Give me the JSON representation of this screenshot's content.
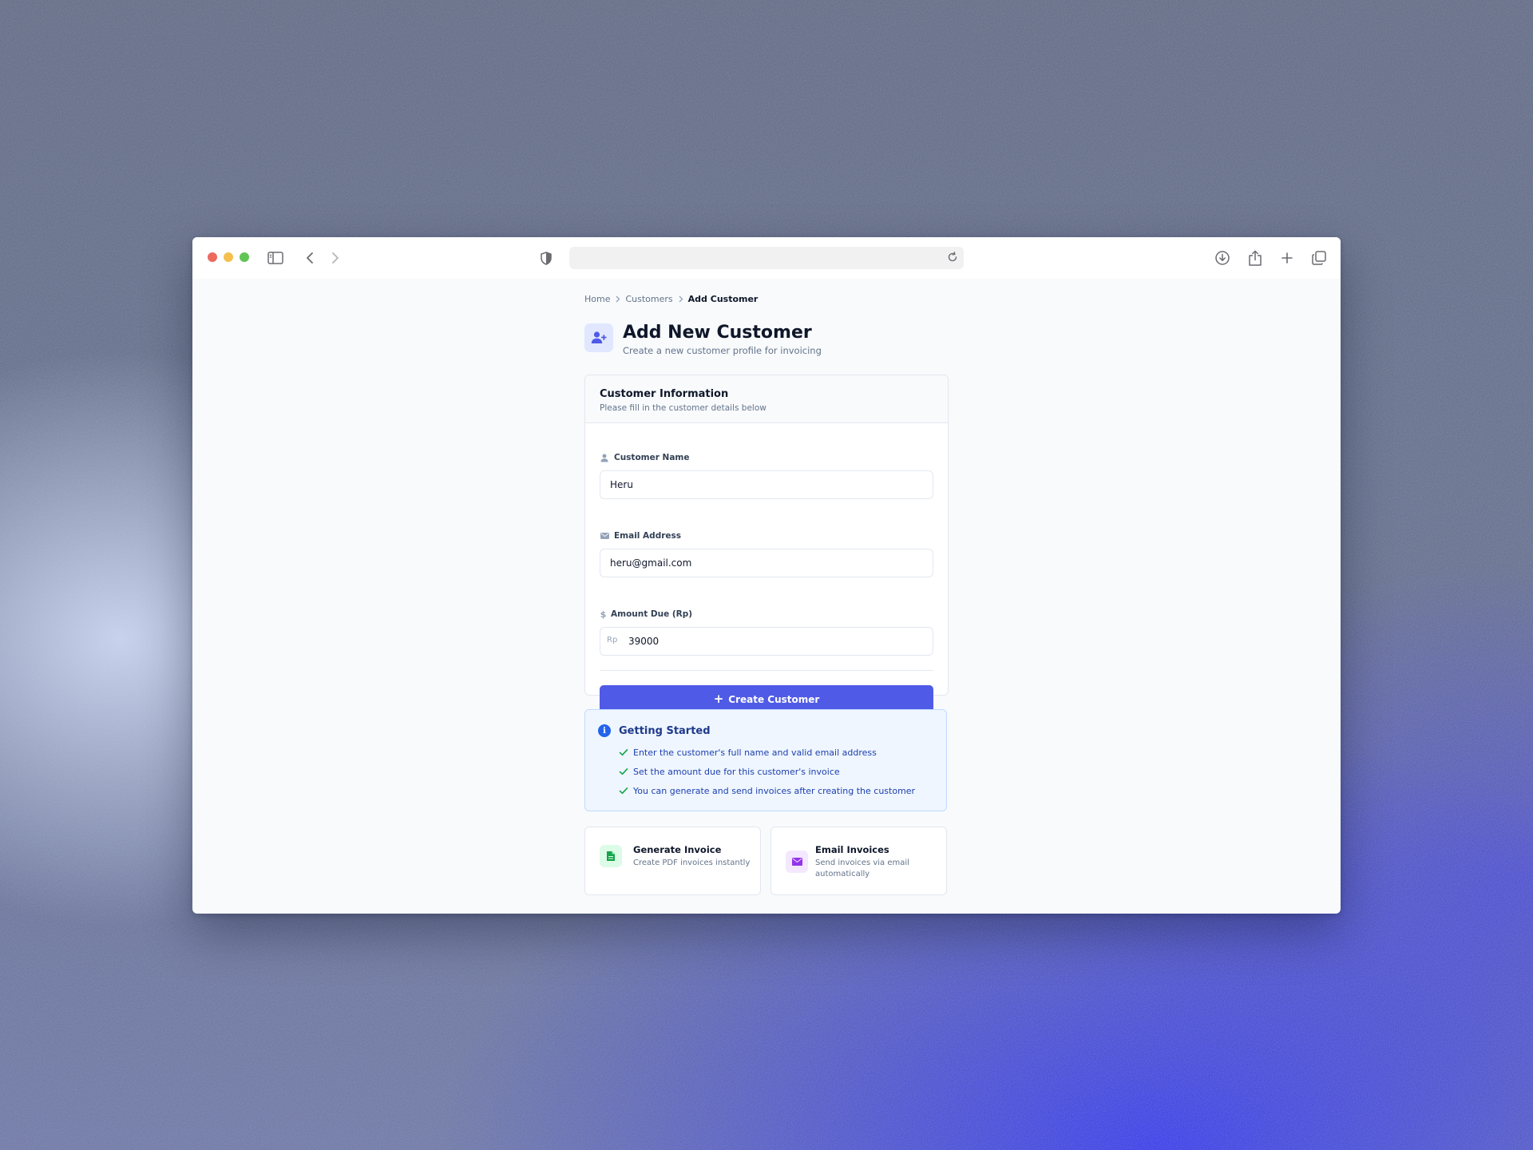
{
  "colors": {
    "primary": "#4f5ae6",
    "info_bg": "#eff6ff",
    "info_text": "#1e40af",
    "check": "#16a34a",
    "feature_green": "#16a34a",
    "feature_purple": "#9333ea"
  },
  "browser": {
    "url": "",
    "icons": [
      "sidebar-toggle-icon",
      "back-icon",
      "forward-icon",
      "shield-icon",
      "reload-icon",
      "download-icon",
      "share-icon",
      "new-tab-icon",
      "tabs-overview-icon"
    ]
  },
  "breadcrumb": {
    "home": "Home",
    "customers": "Customers",
    "current": "Add Customer"
  },
  "header": {
    "title": "Add New Customer",
    "subtitle": "Create a new customer profile for invoicing",
    "icon": "user-plus-icon"
  },
  "form_card": {
    "title": "Customer Information",
    "description": "Please fill in the customer details below",
    "fields": {
      "name": {
        "label": "Customer Name",
        "value": "Heru",
        "icon": "user-icon"
      },
      "email": {
        "label": "Email Address",
        "value": "heru@gmail.com",
        "icon": "mail-icon"
      },
      "amount": {
        "label": "Amount Due (Rp)",
        "prefix": "Rp",
        "value": "39000",
        "icon": "dollar-icon"
      }
    },
    "submit_label": "Create Customer"
  },
  "getting_started": {
    "title": "Getting Started",
    "items": [
      "Enter the customer's full name and valid email address",
      "Set the amount due for this customer's invoice",
      "You can generate and send invoices after creating the customer"
    ]
  },
  "features": [
    {
      "title": "Generate Invoice",
      "description": "Create PDF invoices instantly",
      "icon": "document-icon"
    },
    {
      "title": "Email Invoices",
      "description": "Send invoices via email automatically",
      "icon": "envelope-icon"
    }
  ],
  "window_controls": [
    "close",
    "minimize",
    "zoom"
  ]
}
